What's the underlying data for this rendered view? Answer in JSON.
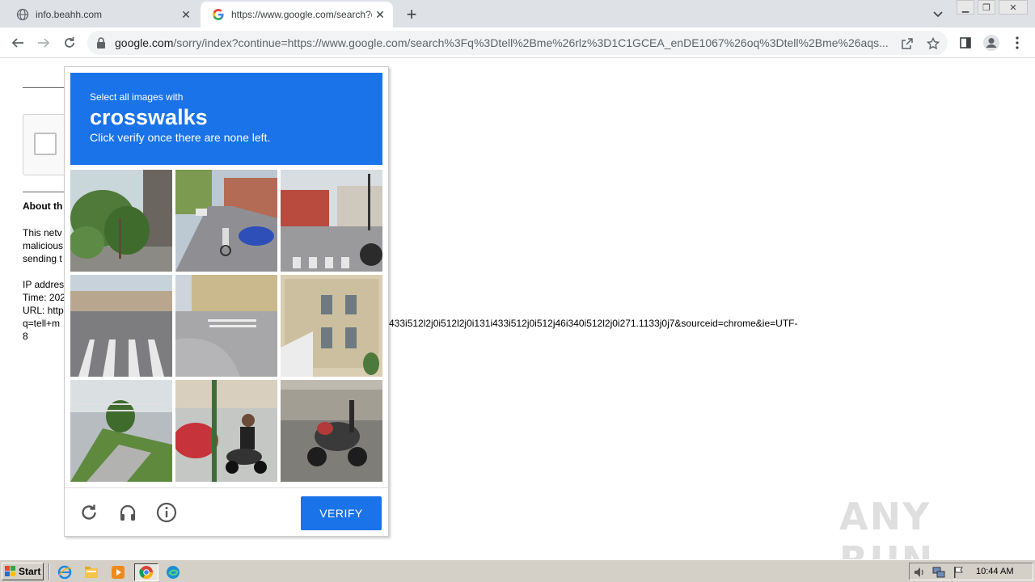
{
  "browser": {
    "tabs": [
      {
        "title": "info.beahh.com",
        "active": false
      },
      {
        "title": "https://www.google.com/search?q=",
        "active": true
      }
    ],
    "url_host": "google.com",
    "url_rest": "/sorry/index?continue=https://www.google.com/search%3Fq%3Dtell%2Bme%26rlz%3D1C1GCEA_enDE1067%26oq%3Dtell%2Bme%26aqs..."
  },
  "page": {
    "about_heading": "About th",
    "para1": [
      "This netv",
      "malicious",
      "sending t"
    ],
    "para2": [
      "IP addres",
      "Time: 202",
      "URL: http",
      "q=tell+m",
      "8"
    ],
    "url_tail": "433i512l2j0i512l2j0i131i433i512j0i512j46i340i512l2j0i271.1133j0j7&sourceid=chrome&ie=UTF-"
  },
  "captcha": {
    "instruction": "Select all images with",
    "target": "crosswalks",
    "subtext": "Click verify once there are none left.",
    "verify_label": "VERIFY",
    "tiles": [
      "palm-street",
      "cyclist-road",
      "intersection-corner",
      "crosswalk-stripes",
      "corner-street",
      "victorian-house",
      "front-steps",
      "motorcyclist",
      "parked-scooter"
    ]
  },
  "watermark": "ANY RUN",
  "taskbar": {
    "start_label": "Start",
    "clock": "10:44 AM"
  },
  "colors": {
    "captcha_blue": "#1a73e8",
    "tabstrip": "#dee1e6",
    "taskbar": "#d4d0c8"
  }
}
